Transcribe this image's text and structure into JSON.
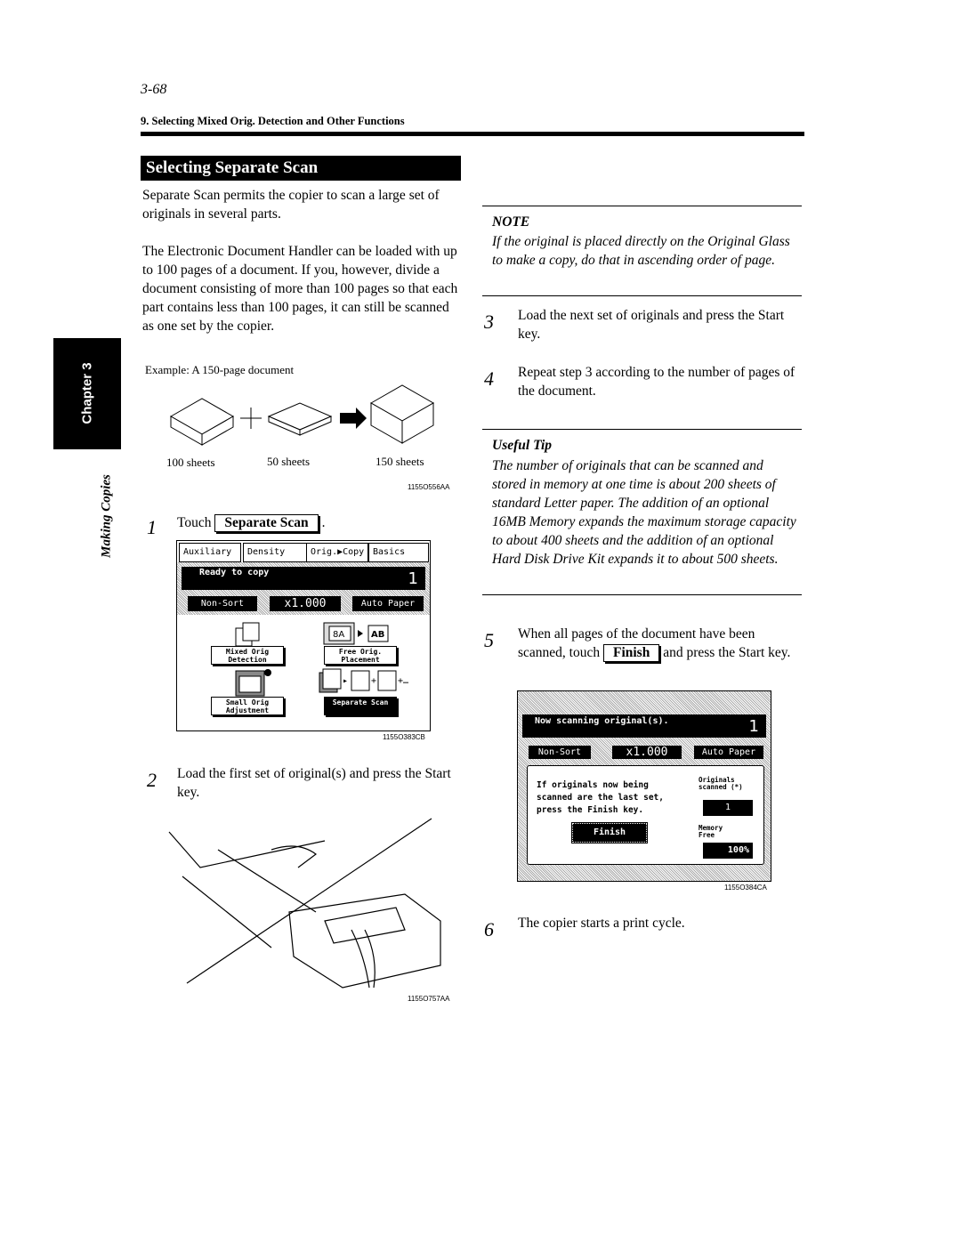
{
  "page_number": "3-68",
  "running_header": "9. Selecting Mixed Orig. Detection and Other Functions",
  "sidebar": {
    "chapter": "Chapter 3",
    "section": "Making Copies"
  },
  "section_title": "Selecting Separate Scan",
  "intro": [
    "Separate Scan permits the copier to scan a large set of originals in several parts.",
    "The Electronic Document Handler can be loaded with up to 100 pages of a document. If you, however, divide a document consisting of more than 100 pages so that each part contains less than 100 pages, it can still be scanned as one set by the copier."
  ],
  "example": {
    "caption": "Example: A 150-page document",
    "labels": [
      "100 sheets",
      "50 sheets",
      "150 sheets"
    ],
    "code": "1155O556AA"
  },
  "steps": [
    {
      "num": "1",
      "pre": "Touch",
      "key": "Separate Scan",
      "post": "."
    },
    {
      "num": "2",
      "text": "Load the first set of original(s) and press the Start key.",
      "code": "1155O757AA"
    },
    {
      "num": "3",
      "text": "Load the next set of originals and press the Start key."
    },
    {
      "num": "4",
      "text": "Repeat step 3 according to the number of pages of the document."
    },
    {
      "num": "5",
      "pre": "When all pages of the document have been scanned, touch",
      "key": "Finish",
      "post": "and press the Start key."
    },
    {
      "num": "6",
      "text": "The copier starts a print cycle."
    }
  ],
  "screen1": {
    "tabs": [
      "Auxiliary",
      "Density",
      "Orig.▶Copy",
      "Basics"
    ],
    "status": "Ready to copy",
    "count": "1",
    "sort": "Non-Sort",
    "zoom": "x1.000",
    "paper": "Auto Paper",
    "buttons": [
      "Mixed Orig Detection",
      "Free Orig. Placement",
      "Small Orig Adjustment",
      "Separate Scan"
    ],
    "code": "1155O383CB"
  },
  "screen2": {
    "status": "Now scanning original(s).",
    "count": "1",
    "sort": "Non-Sort",
    "zoom": "x1.000",
    "paper": "Auto Paper",
    "message": "If originals now being scanned are the last set, press the Finish key.",
    "finish": "Finish",
    "originals_label": "Originals scanned (*)",
    "originals_value": "1",
    "memory_label": "Memory Free",
    "memory_value": "100%",
    "code": "1155O384CA"
  },
  "note": {
    "heading": "NOTE",
    "text": "If the original is placed directly on the Original Glass to make a copy, do that in ascending order of page."
  },
  "tip": {
    "heading": "Useful Tip",
    "text": "The number of originals that can be scanned and stored in memory at one time is about 200 sheets of standard Letter paper. The addition of an optional 16MB Memory expands the maximum storage capacity to about 400 sheets and the addition of an optional Hard Disk Drive Kit expands it to about 500 sheets."
  }
}
